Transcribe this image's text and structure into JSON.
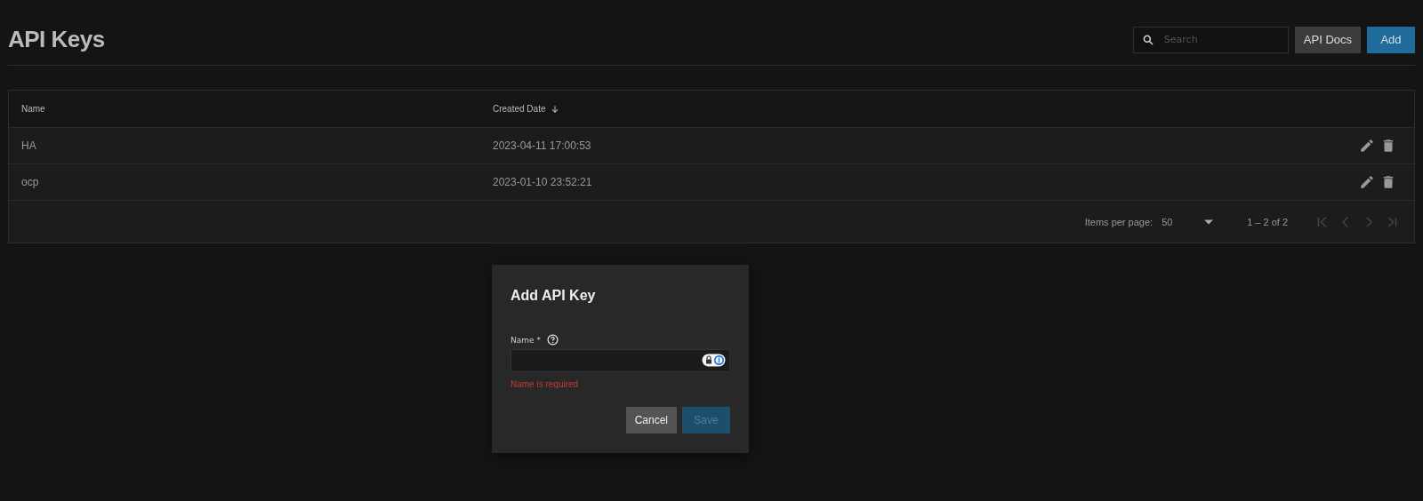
{
  "page": {
    "title": "API Keys"
  },
  "toolbar": {
    "search": {
      "placeholder": "Search"
    },
    "buttons": [
      {
        "label": "API Docs",
        "kind": "secondary"
      },
      {
        "label": "Add",
        "kind": "primary"
      }
    ]
  },
  "table": {
    "columns": [
      {
        "label": "Name",
        "sorted": false
      },
      {
        "label": "Created Date",
        "sorted": true
      }
    ],
    "rows": [
      {
        "name": "HA",
        "created": "2023-04-11 17:00:53"
      },
      {
        "name": "ocp",
        "created": "2023-01-10 23:52:21"
      }
    ],
    "paginator": {
      "items_label": "Items per page:",
      "page_size": "50",
      "range": "1 – 2 of 2"
    }
  },
  "dialog": {
    "title": "Add API Key",
    "field": {
      "label": "Name *",
      "error": "Name is required"
    },
    "buttons": [
      {
        "label": "Cancel",
        "kind": "secondary",
        "disabled": false
      },
      {
        "label": "Save",
        "kind": "primary",
        "disabled": true
      }
    ]
  }
}
